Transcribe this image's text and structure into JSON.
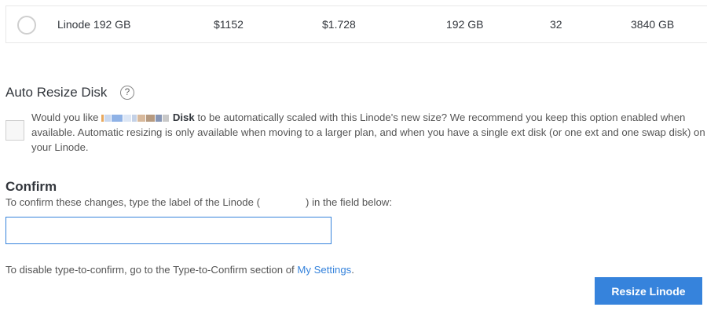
{
  "plan_row": {
    "label": "Linode 192 GB",
    "monthly": "$1152",
    "hourly": "$1.728",
    "ram": "192 GB",
    "cpus": "32",
    "storage": "3840 GB",
    "selected": false
  },
  "auto_resize": {
    "title": "Auto Resize Disk",
    "help_icon": "help-circle-icon",
    "checked": false,
    "text_before": "Would you like ",
    "disk_label": "Disk",
    "text_after": " to be automatically scaled with this Linode's new size? We recommend you keep this option enabled when available. Automatic resizing is only available when moving to a larger plan, and when you have a single ext disk (or one ext and one swap disk) on your Linode."
  },
  "confirm": {
    "title": "Confirm",
    "text_before": "To confirm these changes, type the label of the Linode (",
    "text_after": ") in the field below:",
    "input_value": "",
    "input_placeholder": ""
  },
  "disable_note": {
    "text": "To disable type-to-confirm, go to the Type-to-Confirm section of ",
    "link": "My Settings",
    "after": "."
  },
  "actions": {
    "resize_label": "Resize Linode"
  },
  "colors": {
    "accent": "#3683dc",
    "text": "#32363c",
    "muted": "#555555",
    "border": "#e7e7e7"
  }
}
